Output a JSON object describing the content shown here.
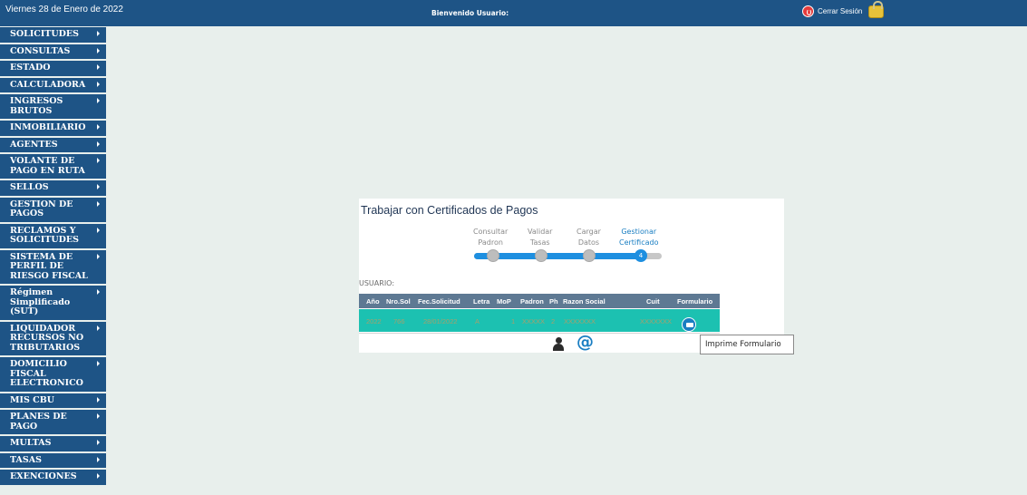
{
  "topbar": {
    "date": "Viernes 28 de Enero de 2022",
    "welcome": "Bienvenido Usuario:",
    "logout_label": "Cerrar Sesión",
    "logout_icon": "power-icon",
    "lock_icon": "lock-icon"
  },
  "sidebar": {
    "items": [
      {
        "label": "SOLICITUDES"
      },
      {
        "label": "CONSULTAS"
      },
      {
        "label": "ESTADO"
      },
      {
        "label": "CALCULADORA"
      },
      {
        "label": "INGRESOS BRUTOS"
      },
      {
        "label": "INMOBILIARIO"
      },
      {
        "label": "AGENTES"
      },
      {
        "label": "VOLANTE DE PAGO EN RUTA"
      },
      {
        "label": "SELLOS"
      },
      {
        "label": "GESTION DE PAGOS"
      },
      {
        "label": "RECLAMOS Y SOLICITUDES"
      },
      {
        "label": "SISTEMA DE PERFIL DE RIESGO FISCAL"
      },
      {
        "label": "Régimen Simplificado (SUT)"
      },
      {
        "label": "LIQUIDADOR RECURSOS NO TRIBUTARIOS"
      },
      {
        "label": "DOMICILIO FISCAL ELECTRONICO"
      },
      {
        "label": "MIS CBU"
      },
      {
        "label": "PLANES DE PAGO"
      },
      {
        "label": "MULTAS"
      },
      {
        "label": "TASAS"
      },
      {
        "label": "EXENCIONES"
      }
    ]
  },
  "panel": {
    "title": "Trabajar con Certificados de Pagos",
    "steps": [
      {
        "line1": "Consultar",
        "line2": "Padron"
      },
      {
        "line1": "Validar",
        "line2": "Tasas"
      },
      {
        "line1": "Cargar",
        "line2": "Datos"
      },
      {
        "line1": "Gestionar",
        "line2": "Certificado"
      }
    ],
    "current_step": "4",
    "progress_fraction": 0.88,
    "user_label": "USUARIO:",
    "table": {
      "headers": [
        "Año",
        "Nro.Sol",
        "Fec.Solicitud",
        "Letra",
        "MoP",
        "Padron",
        "Ph",
        "Razon Social",
        "Cuit",
        "Formulario"
      ],
      "row": [
        "2022",
        "766",
        "28/01/2022",
        "A",
        "1",
        "XXXXX",
        "2",
        "XXXXXXX",
        "XXXXXXX"
      ]
    },
    "print_icon": "print-icon",
    "user_icon": "user-icon",
    "at_symbol": "@"
  },
  "tooltip": {
    "text": "Imprime Formulario"
  },
  "colors": {
    "nav": "#1e5486",
    "accent": "#1e8fe0",
    "row": "#1cc1b1",
    "header": "#5e7993"
  }
}
